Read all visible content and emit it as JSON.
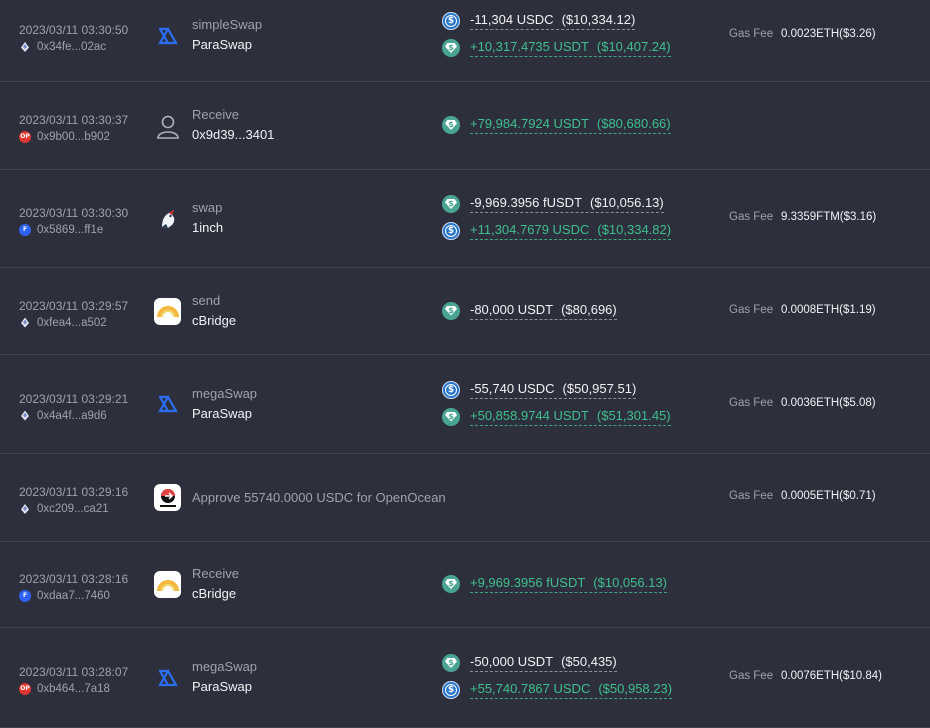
{
  "gas_label": "Gas Fee",
  "rows": [
    {
      "time": "2023/03/11 03:30:50",
      "address": "0x34fe...02ac",
      "chain": "eth",
      "protocol_icon": "paraswap-logo",
      "action": "simpleSwap",
      "target": "ParaSwap",
      "tokens": [
        {
          "icon": "usdc",
          "sign": "neg",
          "amount": "-11,304 USDC",
          "usd": "($10,334.12)"
        },
        {
          "icon": "usdt",
          "sign": "pos",
          "amount": "+10,317.4735 USDT",
          "usd": "($10,407.24)"
        }
      ],
      "gas_fee": "0.0023ETH($3.26)"
    },
    {
      "time": "2023/03/11 03:30:37",
      "address": "0x9b00...b902",
      "chain": "op",
      "protocol_icon": "user-icon",
      "action": "Receive",
      "target": "0x9d39...3401",
      "tokens": [
        {
          "icon": "usdt",
          "sign": "pos",
          "amount": "+79,984.7924 USDT",
          "usd": "($80,680.66)"
        }
      ],
      "gas_fee": ""
    },
    {
      "time": "2023/03/11 03:30:30",
      "address": "0x5869...ff1e",
      "chain": "ftm",
      "protocol_icon": "1inch-logo",
      "action": "swap",
      "target": "1inch",
      "tokens": [
        {
          "icon": "usdt",
          "sign": "neg",
          "amount": "-9,969.3956 fUSDT",
          "usd": "($10,056.13)"
        },
        {
          "icon": "usdc",
          "sign": "pos",
          "amount": "+11,304.7679 USDC",
          "usd": "($10,334.82)"
        }
      ],
      "gas_fee": "9.3359FTM($3.16)"
    },
    {
      "time": "2023/03/11 03:29:57",
      "address": "0xfea4...a502",
      "chain": "eth",
      "protocol_icon": "cbridge-logo",
      "action": "send",
      "target": "cBridge",
      "tokens": [
        {
          "icon": "usdt",
          "sign": "neg",
          "amount": "-80,000 USDT",
          "usd": "($80,696)"
        }
      ],
      "gas_fee": "0.0008ETH($1.19)"
    },
    {
      "time": "2023/03/11 03:29:21",
      "address": "0x4a4f...a9d6",
      "chain": "eth",
      "protocol_icon": "paraswap-logo",
      "action": "megaSwap",
      "target": "ParaSwap",
      "tokens": [
        {
          "icon": "usdc",
          "sign": "neg",
          "amount": "-55,740 USDC",
          "usd": "($50,957.51)"
        },
        {
          "icon": "usdt",
          "sign": "pos",
          "amount": "+50,858.9744 USDT",
          "usd": "($51,301.45)"
        }
      ],
      "gas_fee": "0.0036ETH($5.08)"
    },
    {
      "time": "2023/03/11 03:29:16",
      "address": "0xc209...ca21",
      "chain": "eth",
      "protocol_icon": "openocean-logo",
      "approve_text": "Approve 55740.0000 USDC for OpenOcean",
      "tokens": [],
      "gas_fee": "0.0005ETH($0.71)"
    },
    {
      "time": "2023/03/11 03:28:16",
      "address": "0xdaa7...7460",
      "chain": "ftm",
      "protocol_icon": "cbridge-logo",
      "action": "Receive",
      "target": "cBridge",
      "tokens": [
        {
          "icon": "usdt",
          "sign": "pos",
          "amount": "+9,969.3956 fUSDT",
          "usd": "($10,056.13)"
        }
      ],
      "gas_fee": ""
    },
    {
      "time": "2023/03/11 03:28:07",
      "address": "0xb464...7a18",
      "chain": "op",
      "protocol_icon": "paraswap-logo",
      "action": "megaSwap",
      "target": "ParaSwap",
      "tokens": [
        {
          "icon": "usdt",
          "sign": "neg",
          "amount": "-50,000 USDT",
          "usd": "($50,435)"
        },
        {
          "icon": "usdc",
          "sign": "pos",
          "amount": "+55,740.7867 USDC",
          "usd": "($50,958.23)"
        }
      ],
      "gas_fee": "0.0076ETH($10.84)"
    }
  ]
}
